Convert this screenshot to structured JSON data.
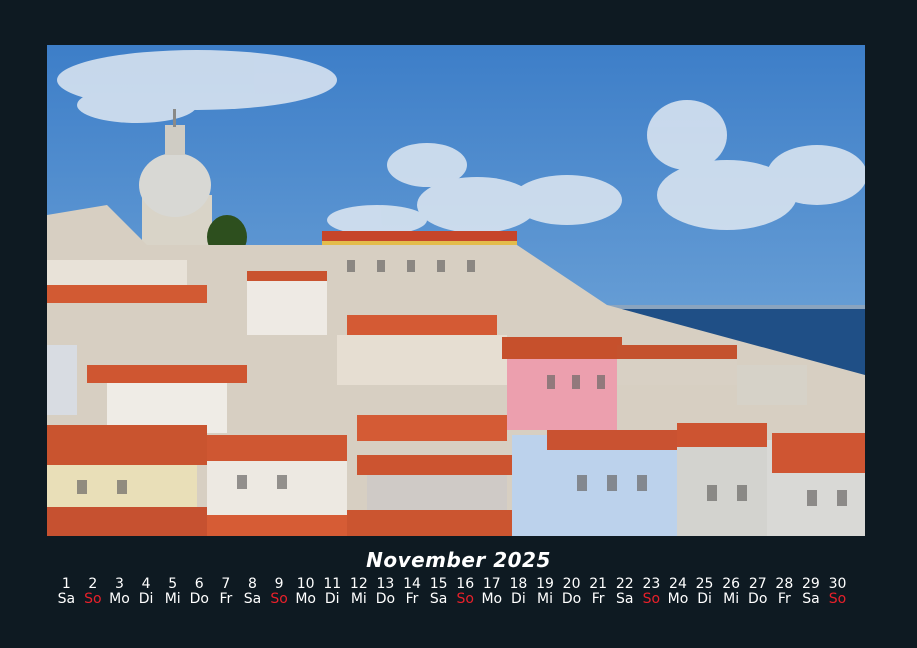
{
  "calendar": {
    "month_title": "November 2025",
    "days": [
      {
        "num": "1",
        "wd": "Sa"
      },
      {
        "num": "2",
        "wd": "So"
      },
      {
        "num": "3",
        "wd": "Mo"
      },
      {
        "num": "4",
        "wd": "Di"
      },
      {
        "num": "5",
        "wd": "Mi"
      },
      {
        "num": "6",
        "wd": "Do"
      },
      {
        "num": "7",
        "wd": "Fr"
      },
      {
        "num": "8",
        "wd": "Sa"
      },
      {
        "num": "9",
        "wd": "So"
      },
      {
        "num": "10",
        "wd": "Mo"
      },
      {
        "num": "11",
        "wd": "Di"
      },
      {
        "num": "12",
        "wd": "Mi"
      },
      {
        "num": "13",
        "wd": "Do"
      },
      {
        "num": "14",
        "wd": "Fr"
      },
      {
        "num": "15",
        "wd": "Sa"
      },
      {
        "num": "16",
        "wd": "So"
      },
      {
        "num": "17",
        "wd": "Mo"
      },
      {
        "num": "18",
        "wd": "Di"
      },
      {
        "num": "19",
        "wd": "Mi"
      },
      {
        "num": "20",
        "wd": "Do"
      },
      {
        "num": "21",
        "wd": "Fr"
      },
      {
        "num": "22",
        "wd": "Sa"
      },
      {
        "num": "23",
        "wd": "So"
      },
      {
        "num": "24",
        "wd": "Mo"
      },
      {
        "num": "25",
        "wd": "Di"
      },
      {
        "num": "26",
        "wd": "Mi"
      },
      {
        "num": "27",
        "wd": "Do"
      },
      {
        "num": "28",
        "wd": "Fr"
      },
      {
        "num": "29",
        "wd": "Sa"
      },
      {
        "num": "30",
        "wd": "So"
      }
    ]
  },
  "colors": {
    "background": "#0e1a22",
    "sunday": "#e8202a",
    "text": "#ffffff"
  }
}
